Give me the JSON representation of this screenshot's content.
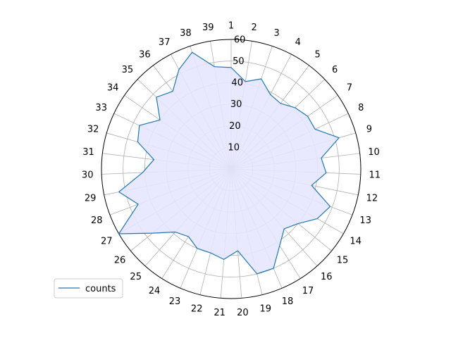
{
  "chart_data": {
    "type": "radar",
    "categories": [
      "1",
      "2",
      "3",
      "4",
      "5",
      "6",
      "7",
      "8",
      "9",
      "10",
      "11",
      "12",
      "13",
      "14",
      "15",
      "16",
      "17",
      "18",
      "19",
      "20",
      "21",
      "22",
      "23",
      "24",
      "25",
      "26",
      "27",
      "28",
      "29",
      "30",
      "31",
      "32",
      "33",
      "34",
      "35",
      "36",
      "37",
      "38",
      "39"
    ],
    "series": [
      {
        "name": "counts",
        "values": [
          47,
          41,
          44,
          39,
          38,
          41,
          43,
          43,
          52,
          42,
          44,
          38,
          49,
          46,
          40,
          37,
          42,
          50,
          50,
          38,
          42,
          40,
          40,
          37,
          39,
          47,
          60,
          46,
          53,
          41,
          36,
          45,
          47,
          40,
          48,
          45,
          52,
          57,
          48
        ],
        "line_color": "#1f77b4",
        "fill_color": "#e6e6ff"
      }
    ],
    "rlim": [
      0,
      60
    ],
    "r_ticks": [
      10,
      20,
      30,
      40,
      50,
      60
    ],
    "r_tick_labels": [
      "10",
      "20",
      "30",
      "40",
      "50",
      "60"
    ],
    "grid": true,
    "legend_position": "lower-left",
    "colors": {
      "grid": "#b0b0b0",
      "frame": "#000000"
    }
  }
}
